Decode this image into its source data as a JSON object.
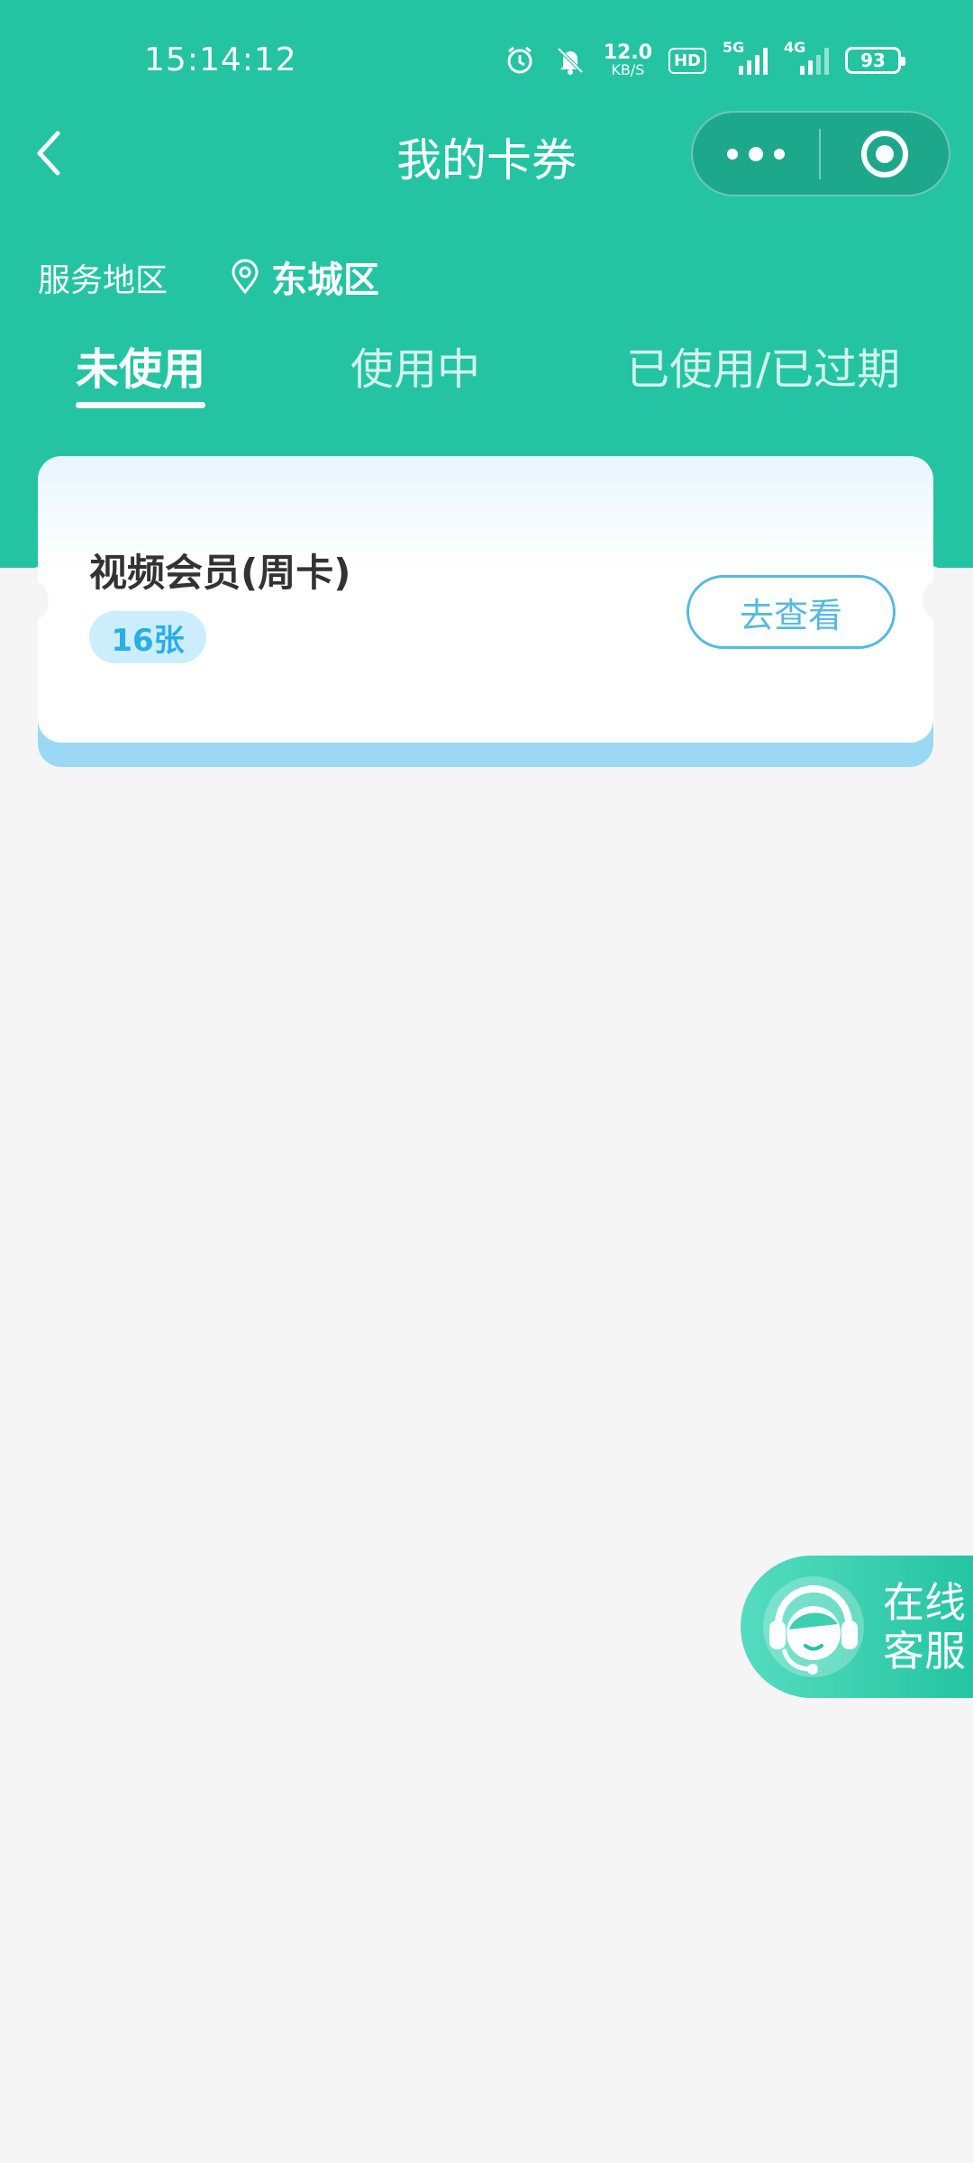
{
  "status_bar": {
    "time": "15:14:12",
    "net_speed_value": "12.0",
    "net_speed_unit": "KB/S",
    "hd_label": "HD",
    "sig1_label": "5G",
    "sig2_label": "4G",
    "battery": "93",
    "icons": [
      "alarm-icon",
      "mute-bell-icon",
      "hd-icon",
      "signal-5g-icon",
      "signal-4g-icon",
      "battery-icon"
    ]
  },
  "nav": {
    "title": "我的卡券"
  },
  "region": {
    "label": "服务地区",
    "value": "东城区"
  },
  "tabs": [
    {
      "label": "未使用",
      "active": true
    },
    {
      "label": "使用中",
      "active": false
    },
    {
      "label": "已使用/已过期",
      "active": false
    }
  ],
  "coupons": [
    {
      "title": "视频会员(周卡)",
      "count": "16张",
      "action": "去查看"
    }
  ],
  "service": {
    "label_line1": "在线",
    "label_line2": "客服"
  },
  "colors": {
    "primary": "#24c4a2",
    "accent_blue": "#56b9e2",
    "badge_bg": "#cceefc"
  }
}
